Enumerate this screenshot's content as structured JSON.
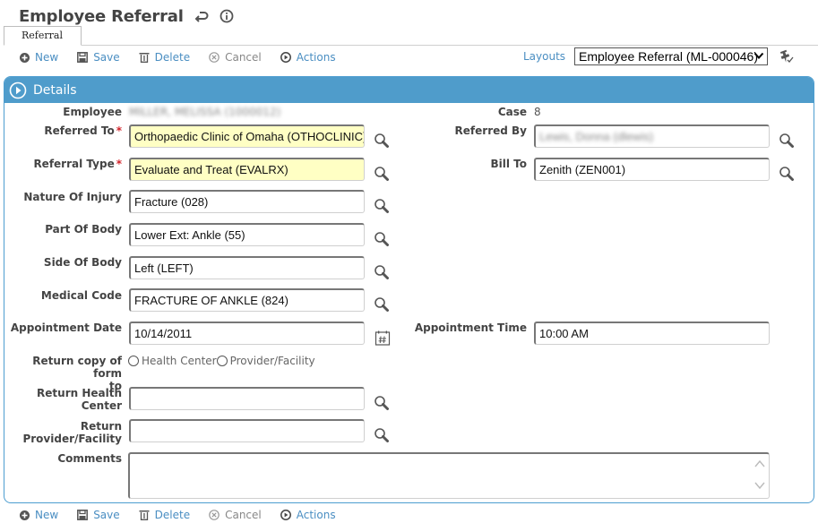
{
  "header": {
    "title": "Employee Referral",
    "icons": [
      "return-icon",
      "info-icon"
    ]
  },
  "tabs": [
    {
      "label": "Referral",
      "active": true
    }
  ],
  "toolbar": {
    "new_label": "New",
    "save_label": "Save",
    "delete_label": "Delete",
    "cancel_label": "Cancel",
    "actions_label": "Actions"
  },
  "layouts": {
    "link_label": "Layouts",
    "selected": "Employee Referral (ML-000046)"
  },
  "panel": {
    "title": "Details"
  },
  "form": {
    "employee": {
      "label": "Employee",
      "value": "MILLER, MELISSA (1000012)",
      "blurred": true
    },
    "case": {
      "label": "Case",
      "value": "8"
    },
    "referred_to": {
      "label": "Referred To",
      "required": true,
      "value": "Orthopaedic Clinic of Omaha (OTHOCLINIC)"
    },
    "referred_by": {
      "label": "Referred By",
      "value": "Lewis, Donna (dlewis)",
      "blurred": true
    },
    "referral_type": {
      "label": "Referral Type",
      "required": true,
      "value": "Evaluate and Treat (EVALRX)"
    },
    "bill_to": {
      "label": "Bill To",
      "value": "Zenith (ZEN001)"
    },
    "nature_of_injury": {
      "label": "Nature Of Injury",
      "value": "Fracture (028)"
    },
    "part_of_body": {
      "label": "Part Of Body",
      "value": "Lower Ext: Ankle (55)"
    },
    "side_of_body": {
      "label": "Side Of Body",
      "value": "Left (LEFT)"
    },
    "medical_code": {
      "label": "Medical Code",
      "value": "FRACTURE OF ANKLE (824)"
    },
    "appointment_date": {
      "label": "Appointment Date",
      "value": "10/14/2011"
    },
    "appointment_time": {
      "label": "Appointment Time",
      "value": "10:00 AM"
    },
    "return_copy": {
      "label_line1": "Return copy of form",
      "label_line2": "to",
      "options": [
        "Health Center",
        "Provider/Facility"
      ],
      "selected": null
    },
    "return_health_center": {
      "label": "Return Health Center",
      "value": ""
    },
    "return_provider": {
      "label_line1": "Return",
      "label_line2": "Provider/Facility",
      "value": ""
    },
    "comments": {
      "label": "Comments",
      "value": ""
    }
  },
  "colors": {
    "accent": "#4f9ccb",
    "link": "#4a8ec2",
    "required_bg": "#ffffc4",
    "required_star": "#d2232a"
  }
}
